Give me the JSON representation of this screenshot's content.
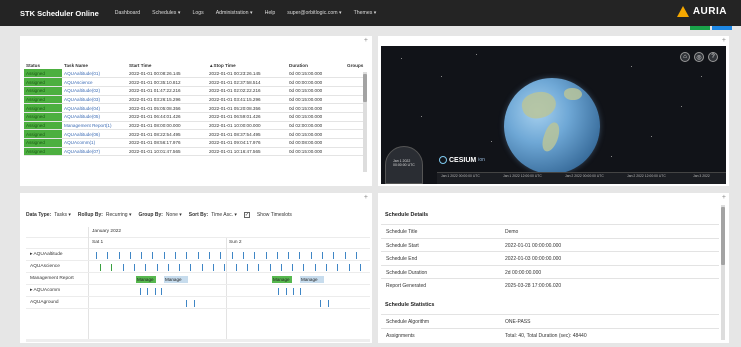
{
  "nav": {
    "brand": "STK Scheduler Online",
    "items": [
      "Dashboard",
      "Schedules ▾",
      "Logs",
      "Administration ▾",
      "Help",
      "super@orbitlogic.com ▾",
      "Themes ▾"
    ],
    "logo_text": "AURIA",
    "logo_color": "#f5a800"
  },
  "tasks": {
    "columns": [
      "Status",
      "Task Name",
      "Start Time",
      "▲Stop Time",
      "Duration",
      "Groups"
    ],
    "rows": [
      [
        "Assigned",
        "AQUAaltitude(01)",
        "2022-01-01 00:08:26.145",
        "2022-01-01 00:23:26.145",
        "0d 00:15:00.000"
      ],
      [
        "Assigned",
        "AQUAscience",
        "2022-01-01 00:35:10.812",
        "2022-01-01 02:37:58.514",
        "0d 00:00:00.000"
      ],
      [
        "Assigned",
        "AQUAaltitude(02)",
        "2022-01-01 01:47:22.216",
        "2022-01-01 02:02:22.216",
        "0d 00:15:00.000"
      ],
      [
        "Assigned",
        "AQUAaltitude(03)",
        "2022-01-01 03:26:15.296",
        "2022-01-01 03:41:15.296",
        "0d 00:15:00.000"
      ],
      [
        "Assigned",
        "AQUAaltitude(04)",
        "2022-01-01 05:05:08.356",
        "2022-01-01 05:20:08.356",
        "0d 00:15:00.000"
      ],
      [
        "Assigned",
        "AQUAaltitude(05)",
        "2022-01-01 06:44:01.426",
        "2022-01-01 06:59:01.426",
        "0d 00:15:00.000"
      ],
      [
        "Assigned",
        "Management Report(1)",
        "2022-01-01 08:00:00.000",
        "2022-01-01 10:00:00.000",
        "0d 02:00:00.000"
      ],
      [
        "Assigned",
        "AQUAaltitude(06)",
        "2022-01-01 08:22:54.495",
        "2022-01-01 08:37:54.495",
        "0d 00:15:00.000"
      ],
      [
        "Assigned",
        "AQUAcomm(1)",
        "2022-01-01 08:56:17.976",
        "2022-01-01 09:04:17.976",
        "0d 00:08:00.000"
      ],
      [
        "Assigned",
        "AQUAaltitude(07)",
        "2022-01-01 10:01:47.565",
        "2022-01-01 10:16:47.565",
        "0d 00:15:00.000"
      ]
    ]
  },
  "viewer": {
    "cesium_label": "CESIUM",
    "cesium_ion": "ion",
    "clock_lines": [
      "Jan 1 2022",
      "00:00:00 UTC"
    ],
    "timeline_ticks": [
      "Jan 1 2022 00:00:00 UTC",
      "Jan 1 2022 12:00:00 UTC",
      "Jan 2 2022 00:00:00 UTC",
      "Jan 2 2022 12:00:00 UTC",
      "Jan 3 2022"
    ],
    "button_glyphs": [
      "⌂",
      "◎",
      "?"
    ]
  },
  "gantt": {
    "toolbar": [
      {
        "label": "Data Type:",
        "value": "Tasks ▾"
      },
      {
        "label": "Rollup By:",
        "value": "Recurring ▾"
      },
      {
        "label": "Group By:",
        "value": "None ▾"
      },
      {
        "label": "Sort By:",
        "value": "Time Asc. ▾"
      }
    ],
    "checkbox_label": "Show Timeslots",
    "checkbox_glyph": "✓",
    "month": "January 2022",
    "days": [
      "Sat 1",
      "Sun 2"
    ],
    "rows": [
      "▸ AQUAaltitude",
      "AQUAscience",
      "Management Report",
      "▸ AQUAcomm",
      "AQUAground"
    ],
    "bar_labels": [
      "Manage",
      "Manage",
      "Manage",
      "Manage"
    ]
  },
  "details": {
    "title": "Schedule Details",
    "rows": [
      {
        "label": "Schedule Title",
        "value": "Demo"
      },
      {
        "label": "Schedule Start",
        "value": "2022-01-01 00:00:00.000"
      },
      {
        "label": "Schedule End",
        "value": "2022-01-03 00:00:00.000"
      },
      {
        "label": "Schedule Duration",
        "value": "2d 00:00:00.000"
      },
      {
        "label": "Report Generated",
        "value": "2025-03-28 17:00:06.020"
      }
    ],
    "stats_title": "Schedule Statistics",
    "stats_rows": [
      {
        "label": "Schedule Algorithm",
        "value": "ONE-PASS"
      },
      {
        "label": "Assignments",
        "value": "Total: 40, Total Duration (sec): 48440"
      }
    ]
  },
  "colors": {
    "nav_bg": "#242424",
    "assigned_green": "#4caf3f",
    "task_link": "#3c6cb5",
    "mark_blue": "#3f86c5",
    "accent_green": "#1aa34a",
    "accent_blue": "#1e88e5"
  },
  "plus_glyph": "+"
}
